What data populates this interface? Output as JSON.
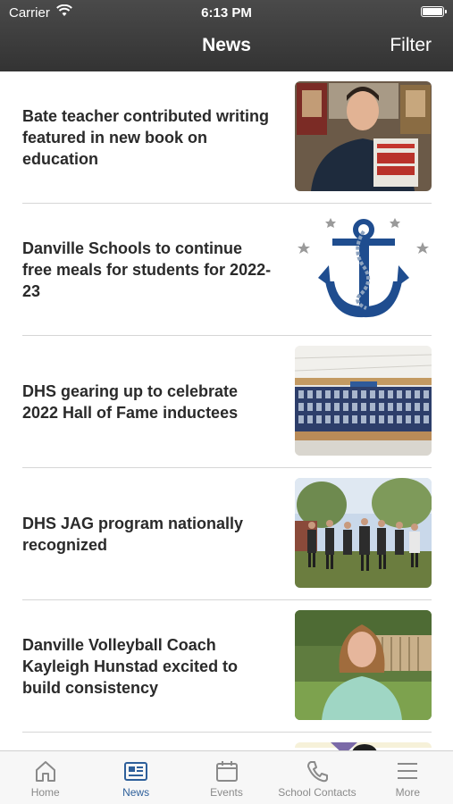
{
  "status_bar": {
    "carrier": "Carrier",
    "time": "6:13 PM"
  },
  "header": {
    "title": "News",
    "filter_label": "Filter"
  },
  "news": [
    {
      "title": "Bate teacher contributed writing featured in new book on education",
      "image": "teacher-holding-book"
    },
    {
      "title": "Danville Schools to continue free meals for students for 2022-23",
      "image": "anchor-logo"
    },
    {
      "title": "DHS gearing up to celebrate 2022 Hall of Fame inductees",
      "image": "hall-of-fame-wall"
    },
    {
      "title": "DHS JAG program nationally recognized",
      "image": "group-outdoors"
    },
    {
      "title": "Danville Volleyball Coach Kayleigh Hunstad excited to build consistency",
      "image": "coach-portrait"
    }
  ],
  "tabs": [
    {
      "label": "Home",
      "icon": "home-icon",
      "active": false
    },
    {
      "label": "News",
      "icon": "newspaper-icon",
      "active": true
    },
    {
      "label": "Events",
      "icon": "calendar-icon",
      "active": false
    },
    {
      "label": "School Contacts",
      "icon": "phone-icon",
      "active": false
    },
    {
      "label": "More",
      "icon": "menu-icon",
      "active": false
    }
  ],
  "colors": {
    "header": "#3d3d3d",
    "accent": "#2d5f9a",
    "tab_inactive": "#8a8a8a",
    "anchor": "#1f4d8f"
  }
}
